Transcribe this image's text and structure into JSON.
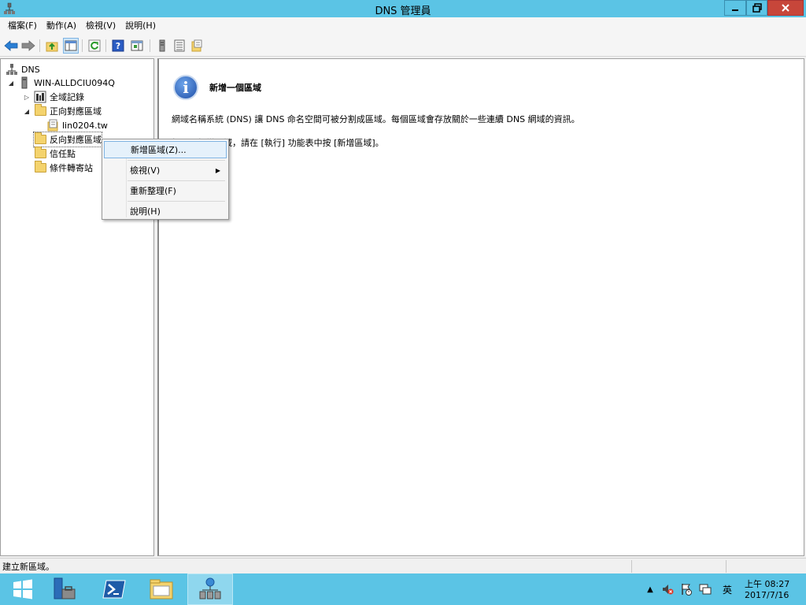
{
  "window": {
    "title": "DNS 管理員"
  },
  "menu": [
    "檔案(F)",
    "動作(A)",
    "檢視(V)",
    "說明(H)"
  ],
  "toolbar_icons": [
    "back-arrow-icon",
    "forward-arrow-icon",
    "up-folder-icon",
    "show-hide-tree-icon",
    "refresh-icon",
    "help-icon",
    "properties-icon",
    "server-icon",
    "list-icon",
    "new-zone-icon"
  ],
  "tree": {
    "root": "DNS",
    "server": "WIN-ALLDCIU094Q",
    "global_logs": "全域記錄",
    "forward_zones": "正向對應區域",
    "zone_lin": "lin0204.tw",
    "reverse_zones": "反向對應區域",
    "trust_points": "信任點",
    "conditional_forwarders": "條件轉寄站"
  },
  "detail": {
    "heading": "新增一個區域",
    "para1": "網域名稱系統 (DNS) 讓 DNS 命名空間可被分割成區域。每個區域會存放關於一些連續 DNS 網域的資訊。",
    "para2": "如果要新增區域，請在 [執行] 功能表中按 [新增區域]。"
  },
  "context_menu": {
    "new_zone": "新增區域(Z)...",
    "view": "檢視(V)",
    "refresh": "重新整理(F)",
    "help": "說明(H)"
  },
  "status": {
    "text": "建立新區域。"
  },
  "tray": {
    "ime": "英",
    "time": "上午 08:27",
    "date": "2017/7/16"
  },
  "colors": {
    "titlebar": "#5bc4e5",
    "taskbar": "#5bc4e5",
    "close_button": "#c7463a",
    "selection": "#e5f1fb"
  }
}
